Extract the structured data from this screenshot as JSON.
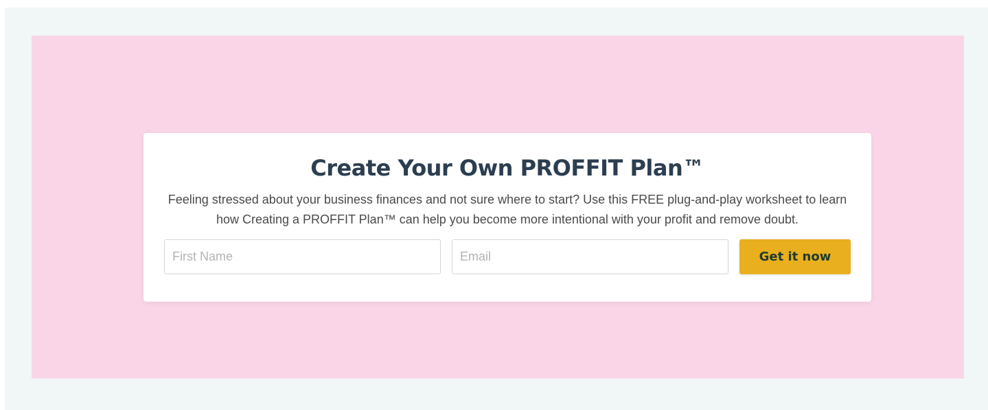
{
  "colors": {
    "outer_background": "#f1f6f6",
    "hero_background": "#f9d5e7",
    "card_background": "#ffffff",
    "title_color": "#2c3e50",
    "button_color": "#e9af1e",
    "button_text_color": "#1f3b2e"
  },
  "signup": {
    "title": "Create Your Own PROFFIT Plan™",
    "description": "Feeling stressed about your business finances and not sure where to start? Use this FREE plug-and-play worksheet to learn how Creating a PROFFIT Plan™ can help you become more intentional with your profit and remove doubt.",
    "first_name": {
      "placeholder": "First Name",
      "value": ""
    },
    "email": {
      "placeholder": "Email",
      "value": ""
    },
    "submit_label": "Get it now"
  }
}
